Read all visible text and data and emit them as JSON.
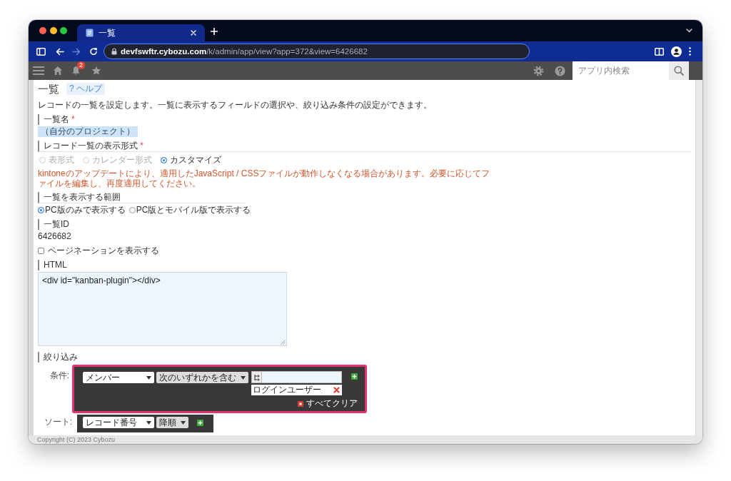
{
  "browser": {
    "tabs": [
      {
        "title": "一覧",
        "selected": true
      }
    ],
    "url": "**devfswftr.cybozu.com**/k/admin/app/view?app=372&view=6426682"
  },
  "app_header": {
    "notification_count": "2",
    "search": {
      "placeholder": "アプリ内検索"
    }
  },
  "page": {
    "title": "一覧",
    "help_link": "? ヘルプ",
    "description": "レコードの一覧を設定します。一覧に表示するフィールドの選択や、絞り込み条件の設定ができます。",
    "fields": [
      {
        "kind": "text",
        "label": "一覧名",
        "required_mark": "*",
        "value": "（自分のプロジェクト）",
        "highlighted": true
      },
      {
        "kind": "radio_row",
        "label": "レコード一覧の表示形式",
        "required_mark": "*",
        "options": [
          {
            "label": "表形式",
            "selected": false,
            "disabled": true
          },
          {
            "label": "カレンダー形式",
            "selected": false,
            "disabled": true
          },
          {
            "label": "カスタマイズ",
            "selected": true,
            "disabled": false
          }
        ],
        "warning": "kintoneのアップデートにより、適用したJavaScript / CSSファイルが動作しなくなる場合があります。必要に応じてファイルを編集し、再度適用してください。"
      },
      {
        "kind": "radio_compact",
        "label": "一覧を表示する範囲",
        "options": [
          {
            "label": "PC版のみで表示する",
            "selected": true
          },
          {
            "label": "PC版とモバイル版で表示する",
            "selected": false
          }
        ]
      },
      {
        "kind": "text",
        "label": "一覧ID",
        "value": "6426682",
        "highlighted": false
      },
      {
        "kind": "checkbox",
        "label": "ページネーションを表示する",
        "checked": false
      },
      {
        "kind": "code",
        "label": "HTML",
        "value": "<div id=\"kanban-plugin\"></div>"
      }
    ],
    "filter": {
      "label": "絞り込み",
      "highlighted": true,
      "condition_label": "条件:",
      "conditions": [
        {
          "field": "メンバー",
          "operator": "次のいずれかを含む",
          "values": [
            "ログインユーザー"
          ]
        }
      ],
      "clear_all": "すべてクリア"
    },
    "sort": {
      "label": "ソート:",
      "field": "レコード番号",
      "order": "降順"
    }
  },
  "footer": {
    "copyright": "Copyright (C) 2023 Cybozu"
  }
}
